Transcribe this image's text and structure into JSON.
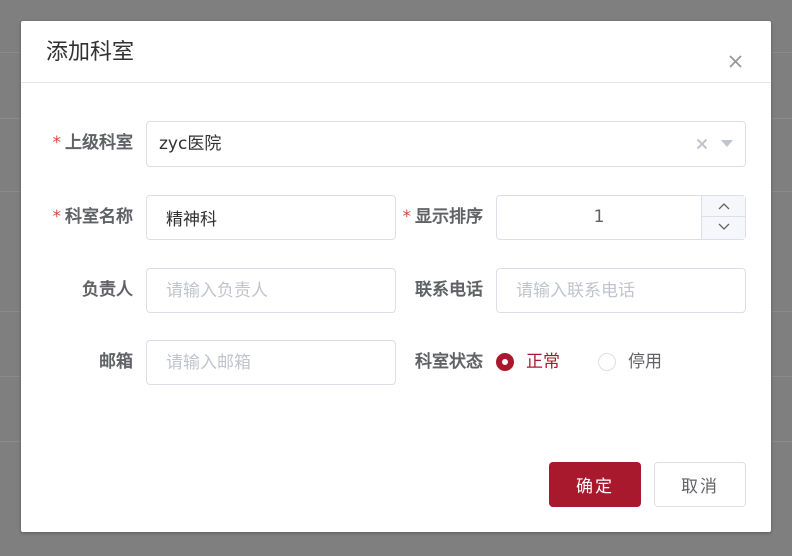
{
  "dialog": {
    "title": "添加科室"
  },
  "form": {
    "parent_dept": {
      "label": "上级科室",
      "required": "*",
      "value": "zyc医院"
    },
    "dept_name": {
      "label": "科室名称",
      "required": "*",
      "value": "精神科"
    },
    "sort_order": {
      "label": "显示排序",
      "required": "*",
      "value": "1"
    },
    "leader": {
      "label": "负责人",
      "placeholder": "请输入负责人"
    },
    "phone": {
      "label": "联系电话",
      "placeholder": "请输入联系电话"
    },
    "email": {
      "label": "邮箱",
      "placeholder": "请输入邮箱"
    },
    "status": {
      "label": "科室状态",
      "options": [
        {
          "label": "正常",
          "checked": true
        },
        {
          "label": "停用",
          "checked": false
        }
      ]
    }
  },
  "footer": {
    "confirm_label": "确定",
    "cancel_label": "取消"
  },
  "colors": {
    "primary": "#a8192e",
    "required": "#e0463f",
    "overlay": "#7f7f7f"
  },
  "icons": [
    "close-icon",
    "clear-icon",
    "caret-down-icon",
    "chevron-up-icon",
    "chevron-down-icon"
  ]
}
